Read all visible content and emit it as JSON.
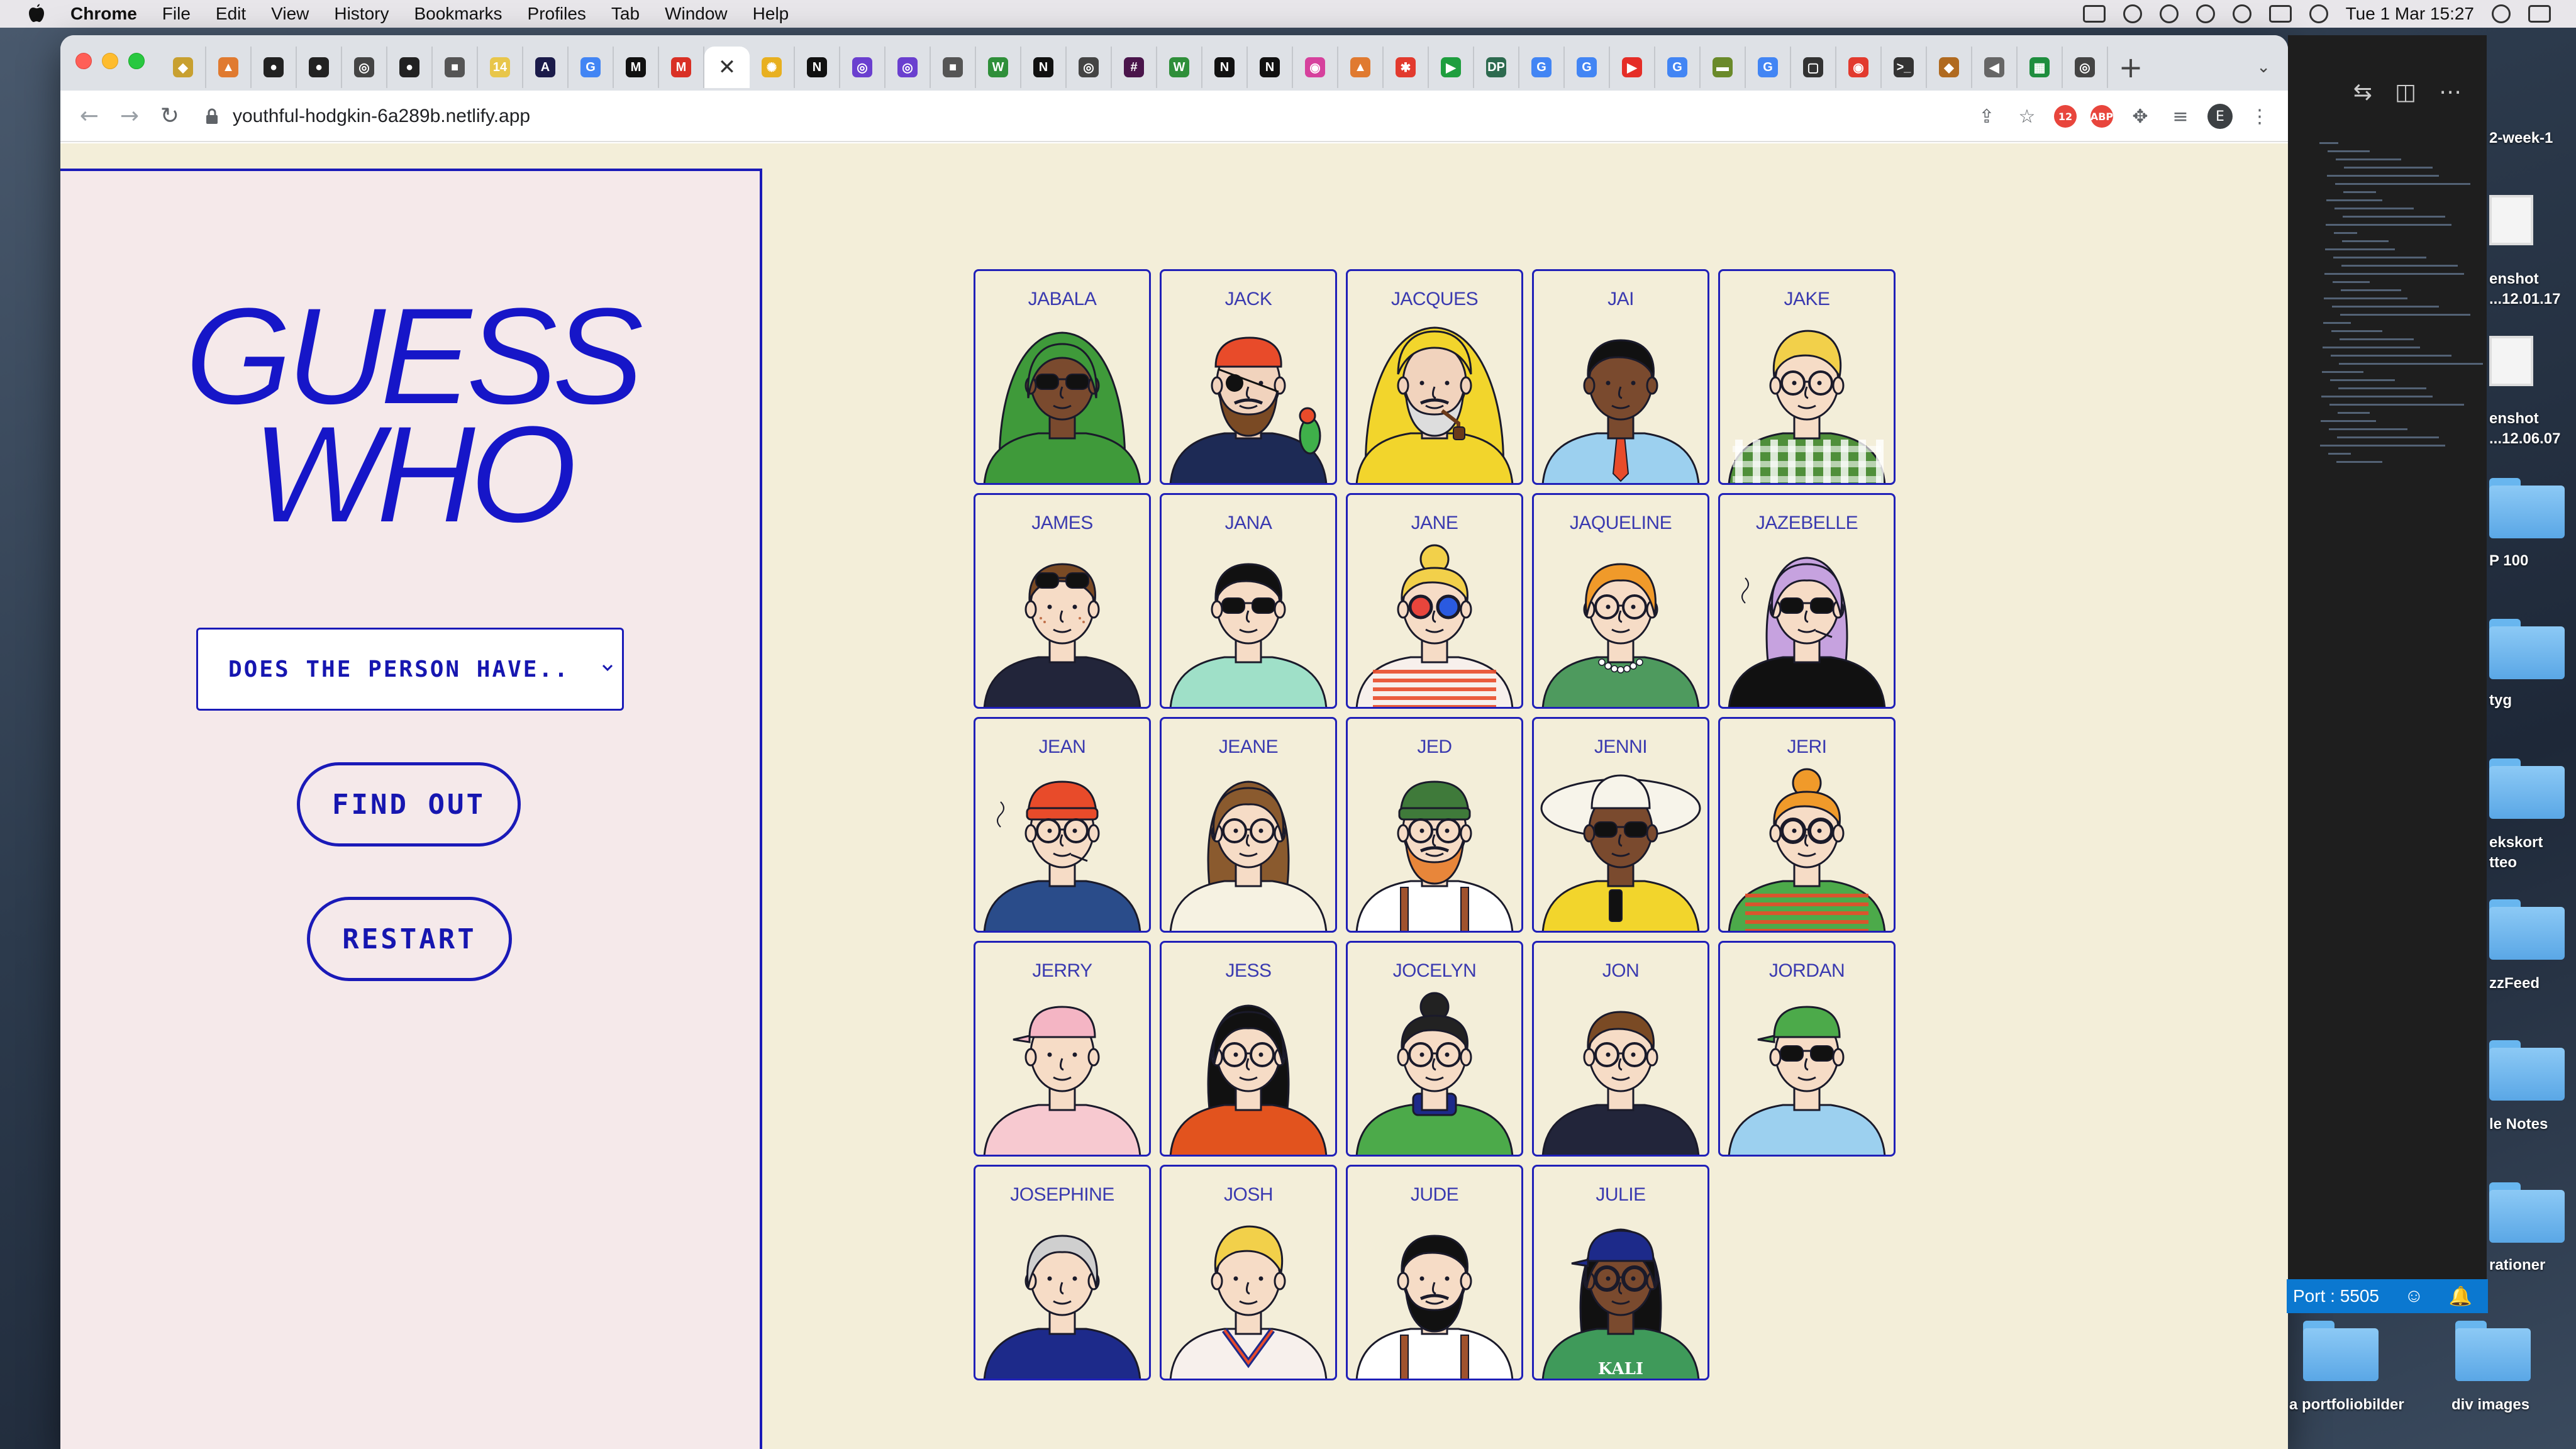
{
  "menubar": {
    "app": "Chrome",
    "items": [
      "File",
      "Edit",
      "View",
      "History",
      "Bookmarks",
      "Profiles",
      "Tab",
      "Window",
      "Help"
    ],
    "clock": "Tue 1 Mar  15:27"
  },
  "browser": {
    "url": "youthful-hodgkin-6a289b.netlify.app",
    "profile_initial": "E",
    "tabs": [
      {
        "icon": "duck-icon",
        "glyph": "◆",
        "color": "#c8a030"
      },
      {
        "icon": "rocket-icon",
        "glyph": "▲",
        "color": "#e07a30"
      },
      {
        "icon": "github-icon",
        "glyph": "●",
        "color": "#222222"
      },
      {
        "icon": "github-icon",
        "glyph": "●",
        "color": "#222222"
      },
      {
        "icon": "globe-icon",
        "glyph": "◎",
        "color": "#444444"
      },
      {
        "icon": "github-icon",
        "glyph": "●",
        "color": "#222222"
      },
      {
        "icon": "cube-icon",
        "glyph": "■",
        "color": "#555555"
      },
      {
        "icon": "notes-icon",
        "glyph": "14",
        "color": "#e8c64a"
      },
      {
        "icon": "figma-icon",
        "glyph": "A",
        "color": "#1b1b4a"
      },
      {
        "icon": "google-icon",
        "glyph": "G",
        "color": "#4285f4"
      },
      {
        "icon": "medium-icon",
        "glyph": "M",
        "color": "#111111"
      },
      {
        "icon": "gmail-icon",
        "glyph": "M",
        "color": "#d93025"
      },
      {
        "icon": "guess-who-icon",
        "glyph": "✕",
        "color": "#ffffff",
        "active": true
      },
      {
        "icon": "sun-icon",
        "glyph": "✺",
        "color": "#e8b020"
      },
      {
        "icon": "notion-icon",
        "glyph": "N",
        "color": "#111111"
      },
      {
        "icon": "circle-icon",
        "glyph": "◎",
        "color": "#6a3fcf"
      },
      {
        "icon": "circle-icon",
        "glyph": "◎",
        "color": "#6a3fcf"
      },
      {
        "icon": "cube-icon",
        "glyph": "■",
        "color": "#555555"
      },
      {
        "icon": "w-icon",
        "glyph": "W",
        "color": "#2f8f3a"
      },
      {
        "icon": "notion-icon",
        "glyph": "N",
        "color": "#111111"
      },
      {
        "icon": "globe-icon",
        "glyph": "◎",
        "color": "#444444"
      },
      {
        "icon": "slack-icon",
        "glyph": "#",
        "color": "#4a154b"
      },
      {
        "icon": "w-icon",
        "glyph": "W",
        "color": "#2f8f3a"
      },
      {
        "icon": "notion-icon",
        "glyph": "N",
        "color": "#111111"
      },
      {
        "icon": "notion-icon",
        "glyph": "N",
        "color": "#111111"
      },
      {
        "icon": "color-icon",
        "glyph": "◉",
        "color": "#d6419d"
      },
      {
        "icon": "rocket-icon",
        "glyph": "▲",
        "color": "#e07a30"
      },
      {
        "icon": "asterisk-icon",
        "glyph": "✱",
        "color": "#e23a2e"
      },
      {
        "icon": "play-icon",
        "glyph": "▶",
        "color": "#1e9e3e"
      },
      {
        "icon": "dp-icon",
        "glyph": "DP",
        "color": "#2d6a4f"
      },
      {
        "icon": "google-icon",
        "glyph": "G",
        "color": "#4285f4"
      },
      {
        "icon": "google-icon",
        "glyph": "G",
        "color": "#4285f4"
      },
      {
        "icon": "youtube-icon",
        "glyph": "▶",
        "color": "#e52d27"
      },
      {
        "icon": "google-icon",
        "glyph": "G",
        "color": "#4285f4"
      },
      {
        "icon": "bar-icon",
        "glyph": "▬",
        "color": "#6a8a2a"
      },
      {
        "icon": "google-icon",
        "glyph": "G",
        "color": "#4285f4"
      },
      {
        "icon": "frame-icon",
        "glyph": "▢",
        "color": "#333333"
      },
      {
        "icon": "target-icon",
        "glyph": "◉",
        "color": "#e23a2e"
      },
      {
        "icon": "terminal-icon",
        "glyph": ">_",
        "color": "#333333"
      },
      {
        "icon": "mask-icon",
        "glyph": "◆",
        "color": "#b06a20"
      },
      {
        "icon": "speaker-icon",
        "glyph": "◀",
        "color": "#666666"
      },
      {
        "icon": "sheets-icon",
        "glyph": "▦",
        "color": "#1e8e3e"
      },
      {
        "icon": "globe-icon",
        "glyph": "◎",
        "color": "#444444"
      }
    ]
  },
  "game": {
    "title_line1": "GUESS",
    "title_line2": "WHO",
    "select_value": "DOES THE PERSON HAVE..",
    "find_out_label": "FIND OUT",
    "restart_label": "RESTART",
    "characters": [
      {
        "name": "JABALA",
        "skin": "#7a4a2e",
        "hair": "#3f9a3a",
        "hairstyle": "hijab",
        "glasses": "sun",
        "hat": "none",
        "shirt": "#3f9a3a",
        "extra": "none"
      },
      {
        "name": "JACK",
        "skin": "#f1d3bd",
        "hair": "#7a4a24",
        "hairstyle": "none",
        "glasses": "patch",
        "hat": "bandana",
        "hat_color": "#e84b2a",
        "shirt": "#1d2a55",
        "extra": "beard-parrot"
      },
      {
        "name": "JACQUES",
        "skin": "#f1d3bd",
        "hair": "#dddddd",
        "hairstyle": "none",
        "glasses": "none",
        "hat": "hood",
        "hat_color": "#f2d52c",
        "shirt": "#f2d52c",
        "extra": "beard-pipe"
      },
      {
        "name": "JAI",
        "skin": "#7a4a2e",
        "hair": "#111111",
        "hairstyle": "short",
        "glasses": "none",
        "hat": "none",
        "shirt": "#9cd0ef",
        "extra": "tie"
      },
      {
        "name": "JAKE",
        "skin": "#f6dcc6",
        "hair": "#f2d04a",
        "hairstyle": "quiff",
        "glasses": "clear",
        "hat": "none",
        "shirt": "#4f8f3a",
        "extra": "check"
      },
      {
        "name": "JAMES",
        "skin": "#f6dcc6",
        "hair": "#7a4a24",
        "hairstyle": "short",
        "glasses": "sun-top",
        "hat": "none",
        "shirt": "#22253a",
        "extra": "freckles"
      },
      {
        "name": "JANA",
        "skin": "#f6dcc6",
        "hair": "#111111",
        "hairstyle": "short",
        "glasses": "sun",
        "hat": "none",
        "shirt": "#9fe0c8",
        "extra": "none"
      },
      {
        "name": "JANE",
        "skin": "#f6dcc6",
        "hair": "#f2d04a",
        "hairstyle": "bun",
        "glasses": "3d",
        "hat": "none",
        "shirt": "#f7f0ec",
        "extra": "stripes"
      },
      {
        "name": "JAQUELINE",
        "skin": "#f6dcc6",
        "hair": "#f09a2a",
        "hairstyle": "bob",
        "glasses": "clear",
        "hat": "none",
        "shirt": "#4e9a5e",
        "extra": "pearls"
      },
      {
        "name": "JAZEBELLE",
        "skin": "#f6dcc6",
        "hair": "#c6a2df",
        "hairstyle": "long",
        "glasses": "sun",
        "hat": "none",
        "shirt": "#111111",
        "extra": "smoke"
      },
      {
        "name": "JEAN",
        "skin": "#f6dcc6",
        "hair": "#e84b2a",
        "hairstyle": "none",
        "glasses": "clear",
        "hat": "beanie",
        "hat_color": "#e84b2a",
        "shirt": "#2a4c8a",
        "extra": "smoke"
      },
      {
        "name": "JEANE",
        "skin": "#f6dcc6",
        "hair": "#8a5a2e",
        "hairstyle": "long",
        "glasses": "clear",
        "hat": "none",
        "shirt": "#f6f2e2",
        "extra": "none"
      },
      {
        "name": "JED",
        "skin": "#f6dcc6",
        "hair": "#e8863a",
        "hairstyle": "none",
        "glasses": "clear",
        "hat": "beanie",
        "hat_color": "#3f7a3a",
        "shirt": "#ffffff",
        "extra": "beard-suspenders"
      },
      {
        "name": "JENNI",
        "skin": "#7a4a2e",
        "hair": "#111111",
        "hairstyle": "none",
        "glasses": "sun",
        "hat": "sunhat",
        "hat_color": "#f7f4ea",
        "shirt": "#f2d52c",
        "extra": "phone"
      },
      {
        "name": "JERI",
        "skin": "#f6dcc6",
        "hair": "#f09a2a",
        "hairstyle": "bun",
        "glasses": "round",
        "hat": "none",
        "shirt": "#4caa4a",
        "extra": "stripes"
      },
      {
        "name": "JERRY",
        "skin": "#f6dcc6",
        "hair": "#7a4a24",
        "hairstyle": "none",
        "glasses": "none",
        "hat": "cap",
        "hat_color": "#f4b5c4",
        "shirt": "#f7c9d0",
        "extra": "none"
      },
      {
        "name": "JESS",
        "skin": "#f6dcc6",
        "hair": "#111111",
        "hairstyle": "long",
        "glasses": "clear",
        "hat": "none",
        "shirt": "#e2531e",
        "extra": "none"
      },
      {
        "name": "JOCELYN",
        "skin": "#f6dcc6",
        "hair": "#222222",
        "hairstyle": "bun",
        "glasses": "clear",
        "hat": "none",
        "shirt": "#4caa4a",
        "extra": "turtleneck"
      },
      {
        "name": "JON",
        "skin": "#f6dcc6",
        "hair": "#7a4a24",
        "hairstyle": "short",
        "glasses": "clear",
        "hat": "none",
        "shirt": "#22253a",
        "extra": "none"
      },
      {
        "name": "JORDAN",
        "skin": "#f6dcc6",
        "hair": "#f2d04a",
        "hairstyle": "none",
        "glasses": "sun",
        "hat": "cap",
        "hat_color": "#4caa4a",
        "shirt": "#9cd0ef",
        "extra": "none"
      },
      {
        "name": "JOSEPHINE",
        "skin": "#f6dcc6",
        "hair": "#cfcfcf",
        "hairstyle": "bob",
        "glasses": "none",
        "hat": "none",
        "shirt": "#1d2a8a",
        "extra": "none"
      },
      {
        "name": "JOSH",
        "skin": "#f6dcc6",
        "hair": "#f2d04a",
        "hairstyle": "quiff",
        "glasses": "none",
        "hat": "none",
        "shirt": "#f7f0ec",
        "extra": "vneck"
      },
      {
        "name": "JUDE",
        "skin": "#f6dcc6",
        "hair": "#111111",
        "hairstyle": "short",
        "glasses": "none",
        "hat": "none",
        "shirt": "#ffffff",
        "extra": "beard-suspenders"
      },
      {
        "name": "JULIE",
        "skin": "#7a4a2e",
        "hair": "#111111",
        "hairstyle": "braids",
        "glasses": "round",
        "hat": "cap",
        "hat_color": "#1d2a8a",
        "shirt": "#3f9a5a",
        "extra": "kali"
      }
    ]
  },
  "desktop": {
    "port_label": "Port : 5505",
    "items": [
      {
        "label": "2-week-1"
      },
      {
        "label": "enshot"
      },
      {
        "label": "...12.01.17"
      },
      {
        "label": "enshot"
      },
      {
        "label": "...12.06.07"
      },
      {
        "label": "P 100"
      },
      {
        "label": "tyg"
      },
      {
        "label": "ekskort"
      },
      {
        "label": "tteo"
      },
      {
        "label": "zzFeed"
      },
      {
        "label": "le Notes"
      },
      {
        "label": "rationer"
      },
      {
        "label": "a portfoliobilder"
      },
      {
        "label": "div images"
      }
    ]
  }
}
